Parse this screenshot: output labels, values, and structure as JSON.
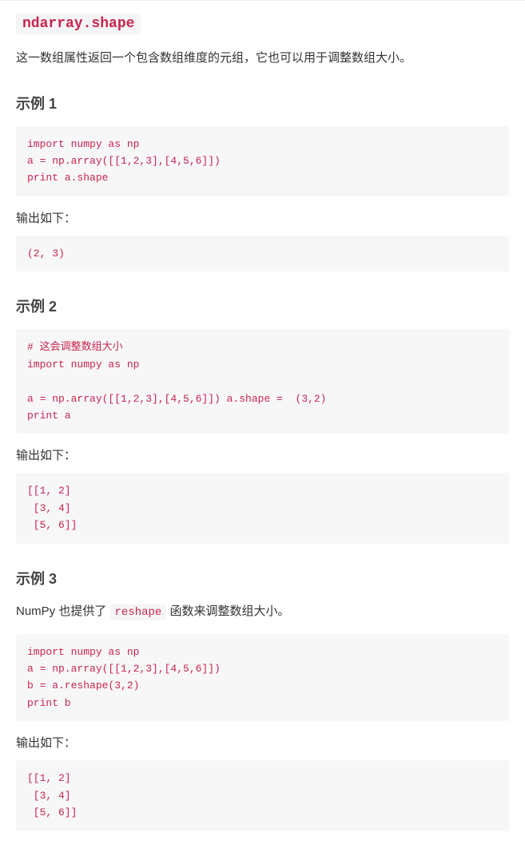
{
  "title_code": "ndarray.shape",
  "intro": "这一数组属性返回一个包含数组维度的元组，它也可以用于调整数组大小。",
  "output_label": "输出如下：",
  "example1": {
    "heading": "示例 1",
    "code": "import numpy as np\na = np.array([[1,2,3],[4,5,6]])\nprint a.shape",
    "output": "(2, 3)"
  },
  "example2": {
    "heading": "示例 2",
    "code": "# 这会调整数组大小\nimport numpy as np\n\na = np.array([[1,2,3],[4,5,6]]) a.shape =  (3,2)\nprint a",
    "output": "[[1, 2]\n [3, 4]\n [5, 6]]"
  },
  "example3": {
    "heading": "示例 3",
    "desc_before": "NumPy 也提供了 ",
    "desc_code": "reshape",
    "desc_after": " 函数来调整数组大小。",
    "code": "import numpy as np\na = np.array([[1,2,3],[4,5,6]])\nb = a.reshape(3,2)\nprint b",
    "output": "[[1, 2]\n [3, 4]\n [5, 6]]"
  }
}
